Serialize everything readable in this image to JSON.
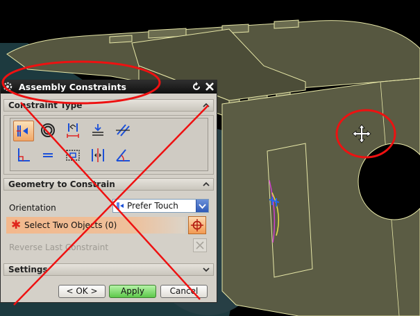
{
  "dialog": {
    "title": "Assembly Constraints",
    "sections": {
      "constraint_type": "Constraint Type",
      "geometry": "Geometry to Constrain",
      "settings": "Settings"
    },
    "orientation": {
      "label": "Orientation",
      "value": "Prefer Touch"
    },
    "select_objects": "Select Two Objects (0)",
    "reverse_last": "Reverse Last Constraint",
    "buttons": {
      "ok": "< OK >",
      "apply": "Apply",
      "cancel": "Cancel"
    },
    "constraint_icons": [
      "touch-align-icon",
      "concentric-icon",
      "distance-icon",
      "fix-icon",
      "parallel-icon",
      "perpendicular-icon",
      "fit-icon",
      "bond-icon",
      "center-icon",
      "angle-icon"
    ]
  },
  "colors": {
    "model_fill": "#54553d",
    "model_edge": "#e8e8a8",
    "dark_teal": "#1e3b40",
    "annotation_red": "#ee1111",
    "selected_accent": "#f2a666"
  }
}
